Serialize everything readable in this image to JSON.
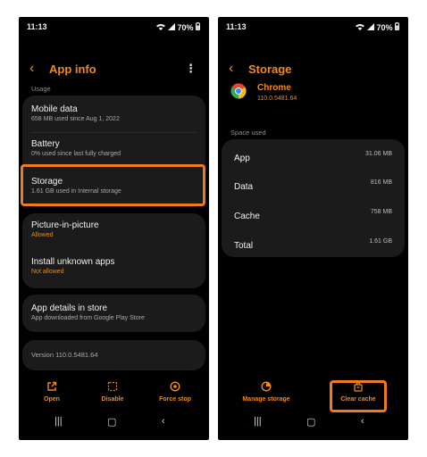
{
  "left": {
    "status": {
      "time": "11:13",
      "battery": "70%"
    },
    "header": {
      "title": "App info"
    },
    "usage_label": "Usage",
    "items": [
      {
        "title": "Mobile data",
        "sub": "658 MB used since Aug 1, 2022"
      },
      {
        "title": "Battery",
        "sub": "0% used since last fully charged"
      },
      {
        "title": "Storage",
        "sub": "1.61 GB used in Internal storage"
      },
      {
        "title": "Picture-in-picture",
        "sub": "Allowed"
      },
      {
        "title": "Install unknown apps",
        "sub": "Not allowed"
      },
      {
        "title": "App details in store",
        "sub": "App downloaded from Google Play Store"
      }
    ],
    "version": "Version 110.0.5481.64",
    "actions": {
      "open": "Open",
      "disable": "Disable",
      "force_stop": "Force stop"
    }
  },
  "right": {
    "status": {
      "time": "11:13",
      "battery": "70%"
    },
    "header": {
      "title": "Storage"
    },
    "app": {
      "name": "Chrome",
      "version": "110.0.5481.64"
    },
    "space_used_label": "Space used",
    "rows": [
      {
        "label": "App",
        "value": "31.06 MB"
      },
      {
        "label": "Data",
        "value": "816 MB"
      },
      {
        "label": "Cache",
        "value": "758 MB"
      },
      {
        "label": "Total",
        "value": "1.61 GB"
      }
    ],
    "actions": {
      "manage": "Manage storage",
      "clear": "Clear cache"
    }
  },
  "colors": {
    "accent": "#f28a1a",
    "highlight": "#f07b1a",
    "card": "#1b1b1b",
    "background": "#010101"
  },
  "icons": [
    "back-arrow-icon",
    "more-options-icon",
    "wifi-icon",
    "signal-icon",
    "battery-icon",
    "open-icon",
    "disable-icon",
    "force-stop-icon",
    "manage-storage-icon",
    "clear-cache-icon",
    "chrome-logo-icon",
    "recents-icon",
    "home-icon",
    "back-icon"
  ]
}
